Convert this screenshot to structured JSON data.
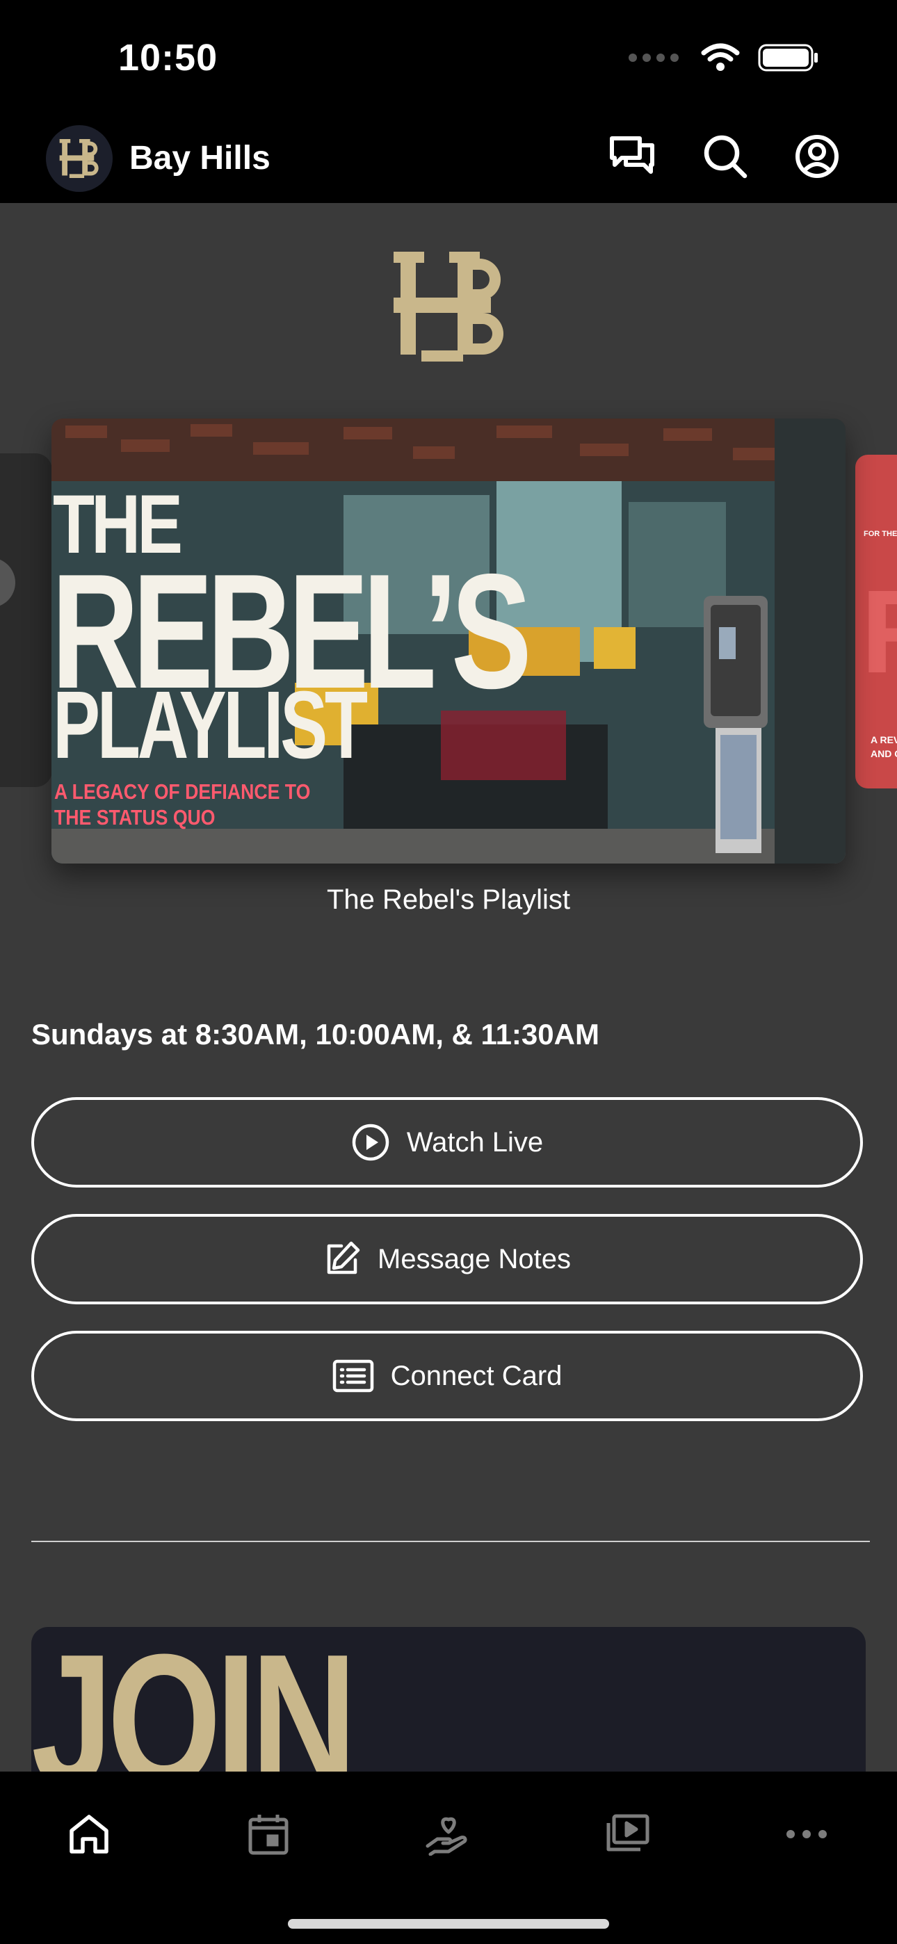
{
  "status_bar": {
    "time": "10:50"
  },
  "header": {
    "app_title": "Bay Hills"
  },
  "hero": {
    "title_line1": "THE",
    "title_line2": "REBEL’S",
    "title_line3": "PLAYLIST",
    "subtitle_line1": "A LEGACY OF DEFIANCE TO",
    "subtitle_line2": "THE STATUS QUO",
    "caption": "The Rebel's Playlist"
  },
  "carousel_next_peek": {
    "small_text": "FOR THE EA",
    "big_text": "RE",
    "sub_text_line1": "A REV",
    "sub_text_line2": "AND CO"
  },
  "service_times": "Sundays at 8:30AM, 10:00AM, & 11:30AM",
  "actions": {
    "watch_live": "Watch Live",
    "message_notes": "Message Notes",
    "connect_card": "Connect Card"
  },
  "promo": {
    "text": "JOIN"
  },
  "tabs": [
    "home-icon",
    "calendar-icon",
    "giving-icon",
    "media-icon",
    "more-icon"
  ],
  "colors": {
    "brand_gold": "#c9b78b",
    "background": "#3a3a3a",
    "bar": "#000000",
    "accent_red": "#ff5a6e"
  }
}
